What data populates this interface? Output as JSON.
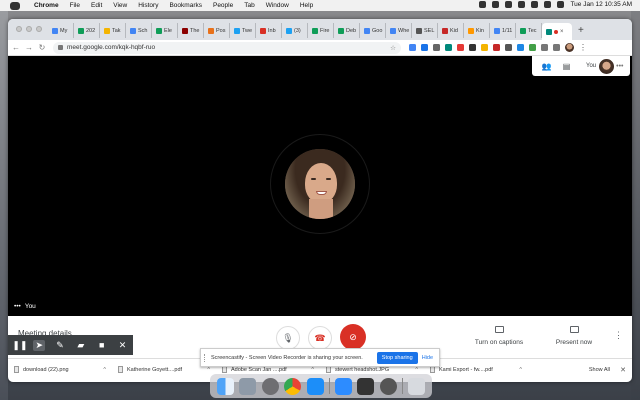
{
  "menubar": {
    "app": "Chrome",
    "items": [
      "File",
      "Edit",
      "View",
      "History",
      "Bookmarks",
      "People",
      "Tab",
      "Window",
      "Help"
    ],
    "clock": "Tue Jan 12  10:35 AM"
  },
  "tabs": [
    {
      "label": "My",
      "color": "#4285f4"
    },
    {
      "label": "202",
      "color": "#0f9d58"
    },
    {
      "label": "Tak",
      "color": "#f4b400"
    },
    {
      "label": "Sch",
      "color": "#4285f4"
    },
    {
      "label": "Ele",
      "color": "#0f9d58"
    },
    {
      "label": "The",
      "color": "#8b0000"
    },
    {
      "label": "Pos",
      "color": "#e8711a"
    },
    {
      "label": "Twe",
      "color": "#1da1f2"
    },
    {
      "label": "Inb",
      "color": "#d93025"
    },
    {
      "label": "(3)",
      "color": "#1da1f2"
    },
    {
      "label": "Fire",
      "color": "#0f9d58"
    },
    {
      "label": "Deb",
      "color": "#0f9d58"
    },
    {
      "label": "Goo",
      "color": "#4285f4"
    },
    {
      "label": "Whe",
      "color": "#4285f4"
    },
    {
      "label": "SEL",
      "color": "#555555"
    },
    {
      "label": "Kid",
      "color": "#c62828"
    },
    {
      "label": "Kin",
      "color": "#ff9800"
    },
    {
      "label": "1/11",
      "color": "#4285f4"
    },
    {
      "label": "Tec",
      "color": "#0f9d58"
    }
  ],
  "toolbar": {
    "url": "meet.google.com/kqk-hqbf-ruo"
  },
  "meet": {
    "self_label": "You",
    "tile_label": "You",
    "meeting_details": "Meeting details",
    "captions_label": "Turn on captions",
    "present_label": "Present now"
  },
  "screencastify": {
    "message": "Screencastify - Screen Video Recorder is sharing your screen.",
    "stop": "Stop sharing",
    "hide": "Hide"
  },
  "downloads": {
    "files": [
      "download (22).png",
      "Katherine Goyett....pdf",
      "Adobe Scan Jan ....pdf",
      "stewert headshot.JPG",
      "Kami Export - fw....pdf"
    ],
    "show_all": "Show All"
  },
  "dock": {
    "apps": [
      "Finder",
      "Launchpad",
      "System Preferences",
      "Chrome",
      "App Store",
      "Zoom",
      "Calculator",
      "Screenshot",
      "Trash"
    ]
  },
  "colors": {
    "accent": "#1a73e8",
    "hangup": "#d93025",
    "meet_bg": "#000000"
  }
}
